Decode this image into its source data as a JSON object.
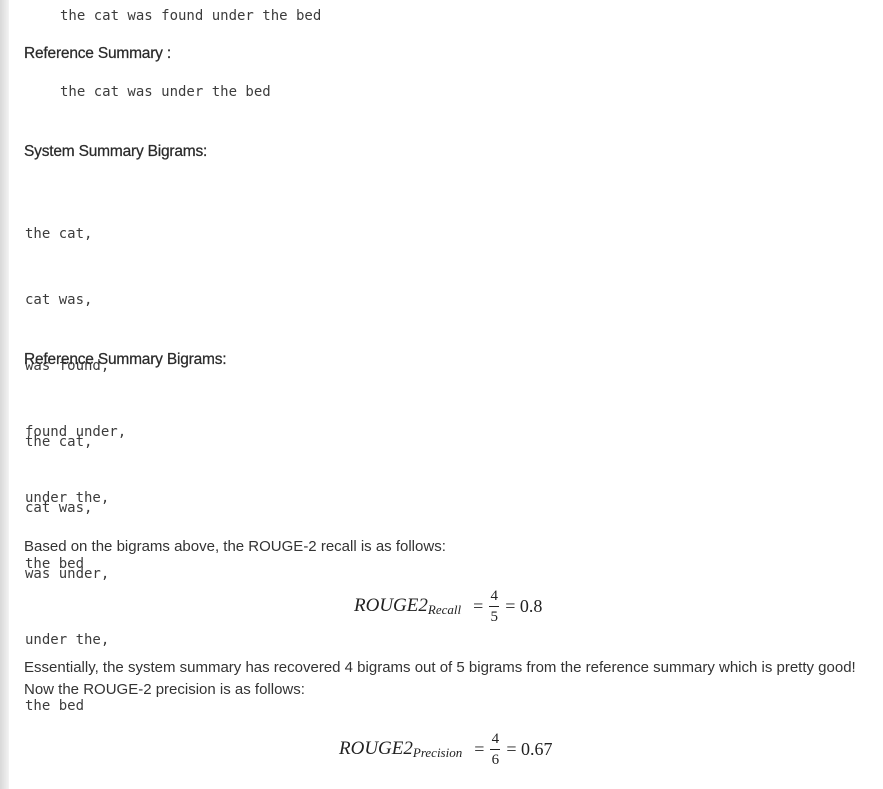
{
  "system_summary_text": "the cat was found under the bed",
  "reference_heading": "Reference Summary :",
  "reference_summary_text": "the cat was under the bed",
  "system_bigrams_heading": "System Summary Bigrams:",
  "system_bigrams": [
    "the cat,",
    "cat was,",
    "was found,",
    "found under,",
    "under the,",
    "the bed"
  ],
  "reference_bigrams_heading": "Reference Summary Bigrams:",
  "reference_bigrams": [
    "the cat,",
    "cat was,",
    "was under,",
    "under the,",
    "the bed"
  ],
  "recall_intro": "Based on the bigrams above, the ROUGE-2 recall is as follows:",
  "recall_formula": {
    "lhs": "ROUGE2",
    "subscript": "Recall",
    "equals": "=",
    "numerator": "4",
    "denominator": "5",
    "result": "= 0.8"
  },
  "explanation_line1": "Essentially, the system summary has recovered 4 bigrams out of 5 bigrams from the reference summary which is pretty good!",
  "explanation_line2": "Now the ROUGE-2 precision is as follows:",
  "precision_formula": {
    "lhs": "ROUGE2",
    "subscript": "Precision",
    "equals": "=",
    "numerator": "4",
    "denominator": "6",
    "result": "= 0.67"
  }
}
